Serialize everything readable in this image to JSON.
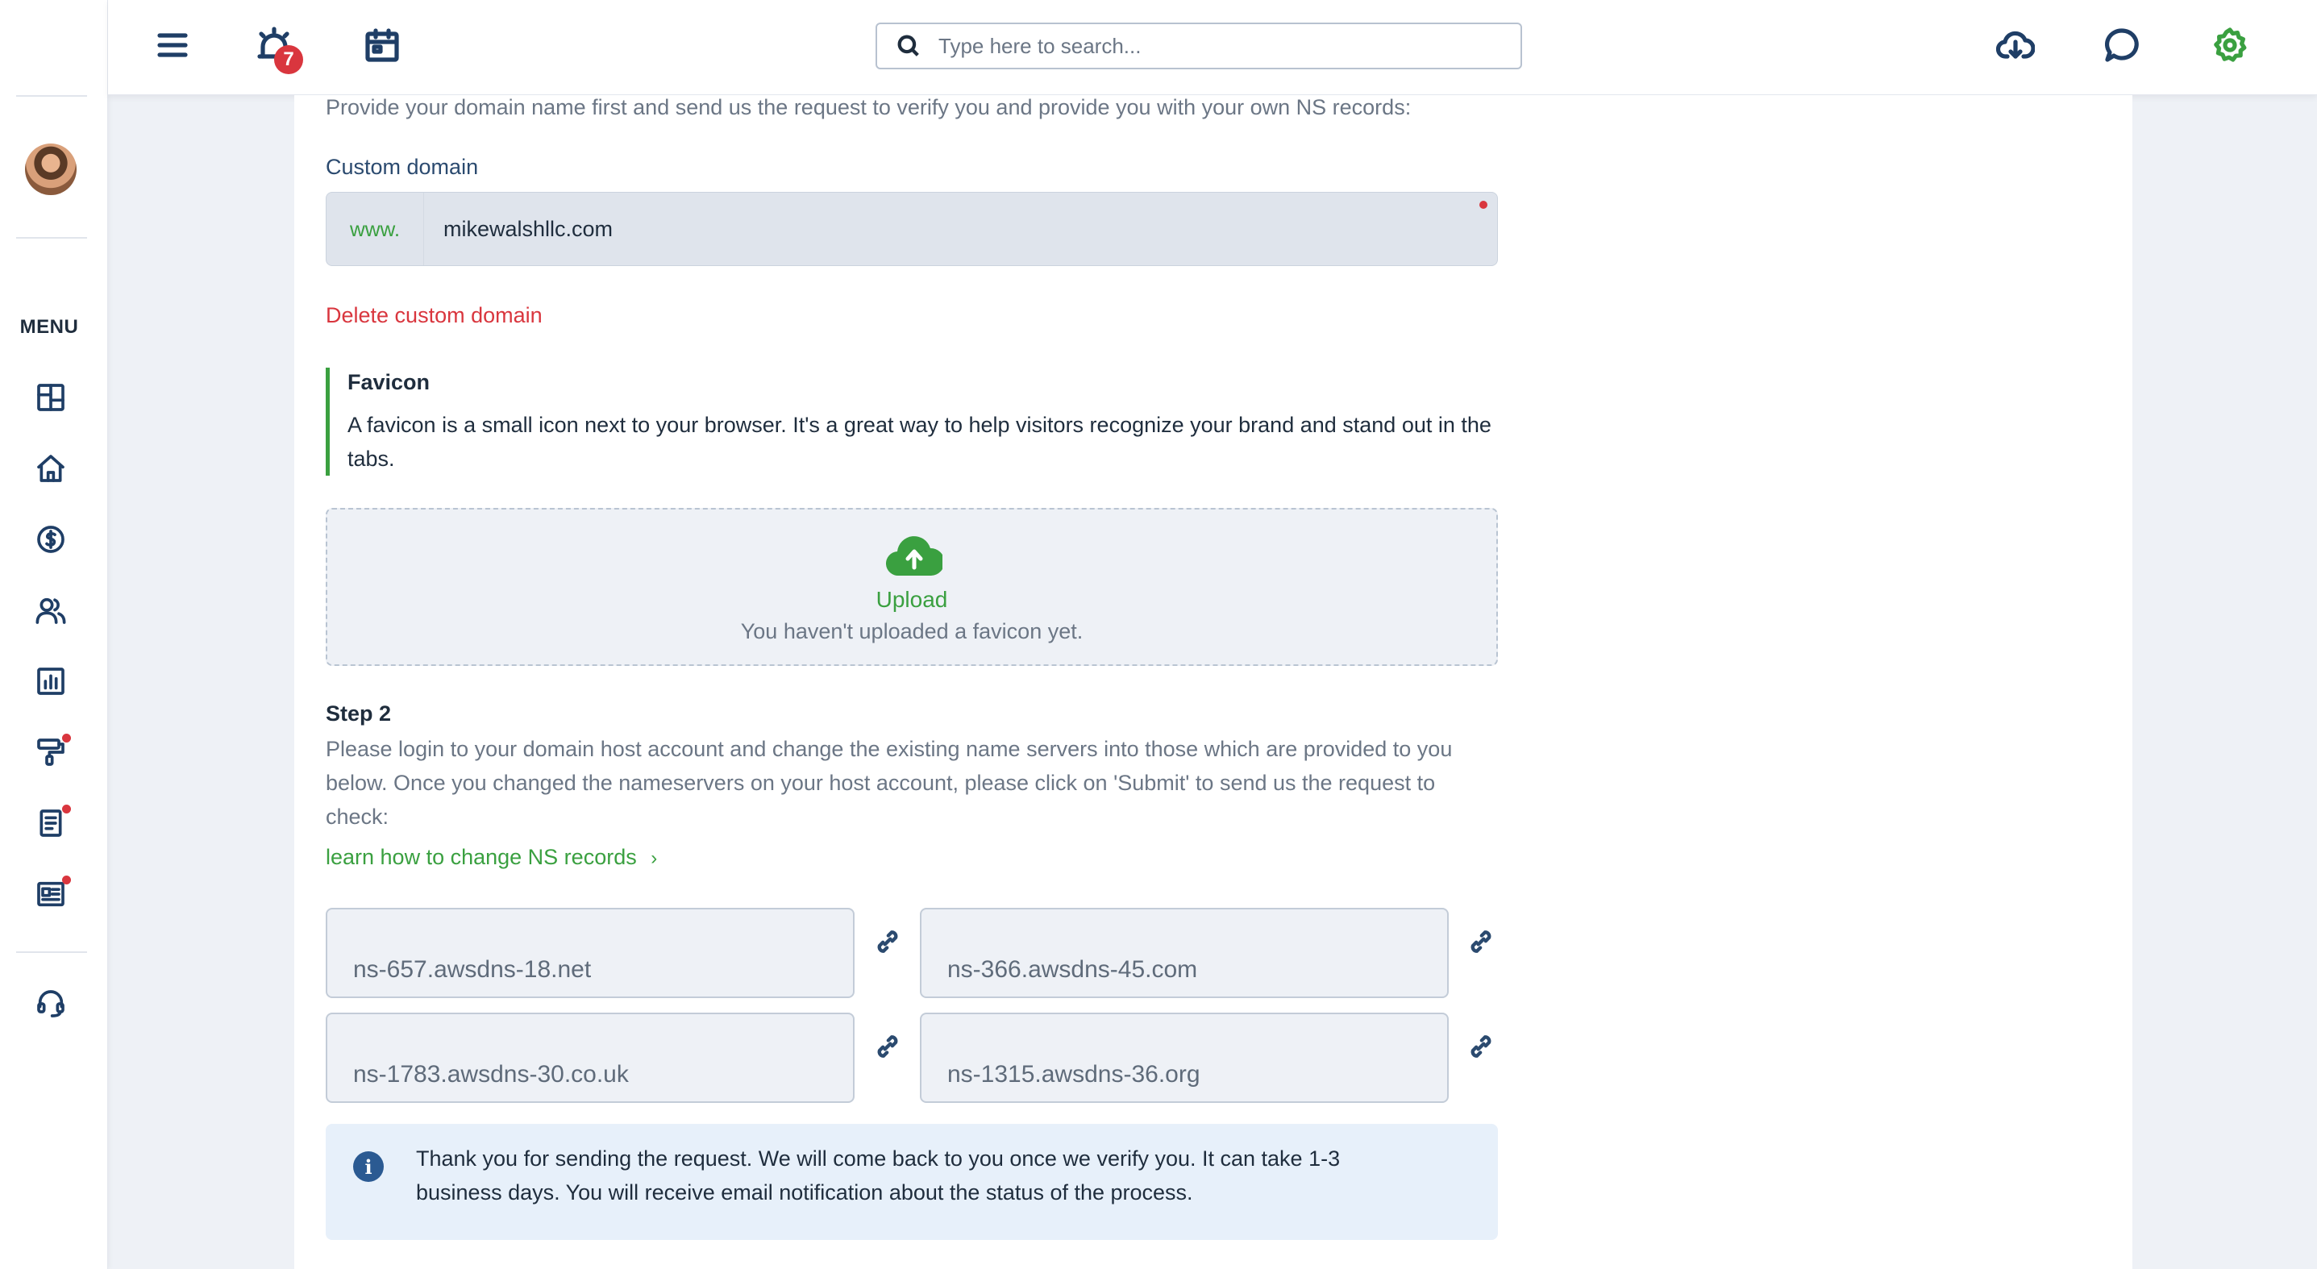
{
  "topbar": {
    "notification_count": "7",
    "search_placeholder": "Type here to search...",
    "accent_color": "#3aa040"
  },
  "sidebar": {
    "menu_label": "MENU",
    "items": [
      {
        "icon": "dashboard-icon"
      },
      {
        "icon": "home-icon"
      },
      {
        "icon": "dollar-icon"
      },
      {
        "icon": "users-icon"
      },
      {
        "icon": "chart-icon"
      },
      {
        "icon": "paint-roller-icon",
        "dot": true
      },
      {
        "icon": "document-icon",
        "dot": true
      },
      {
        "icon": "newspaper-icon",
        "dot": true
      },
      {
        "icon": "support-icon"
      }
    ]
  },
  "main": {
    "intro_text": "Provide your domain name first and send us the request to verify you and provide you with your own NS records:",
    "custom_domain_label": "Custom domain",
    "domain_prefix": "www.",
    "domain_value": "mikewalshllc.com",
    "delete_link": "Delete custom domain",
    "favicon": {
      "title": "Favicon",
      "description": "A favicon is a small icon next to your browser. It's a great way to help visitors recognize your brand and stand out in the tabs.",
      "upload_label": "Upload",
      "upload_status": "You haven't uploaded a favicon yet."
    },
    "step2": {
      "title": "Step 2",
      "text": "Please login to your domain host account and change the existing name servers into those which are provided to you below. Once you changed the nameservers on your host account, please click on 'Submit' to send us the request to check:",
      "learn_link": "learn how to change NS records"
    },
    "ns_records": [
      "ns-657.awsdns-18.net",
      "ns-366.awsdns-45.com",
      "ns-1783.awsdns-30.co.uk",
      "ns-1315.awsdns-36.org"
    ],
    "info_message": "Thank you for sending the request. We will come back to you once we verify you. It can take 1-3 business days. You will receive email notification about the status of the process."
  }
}
